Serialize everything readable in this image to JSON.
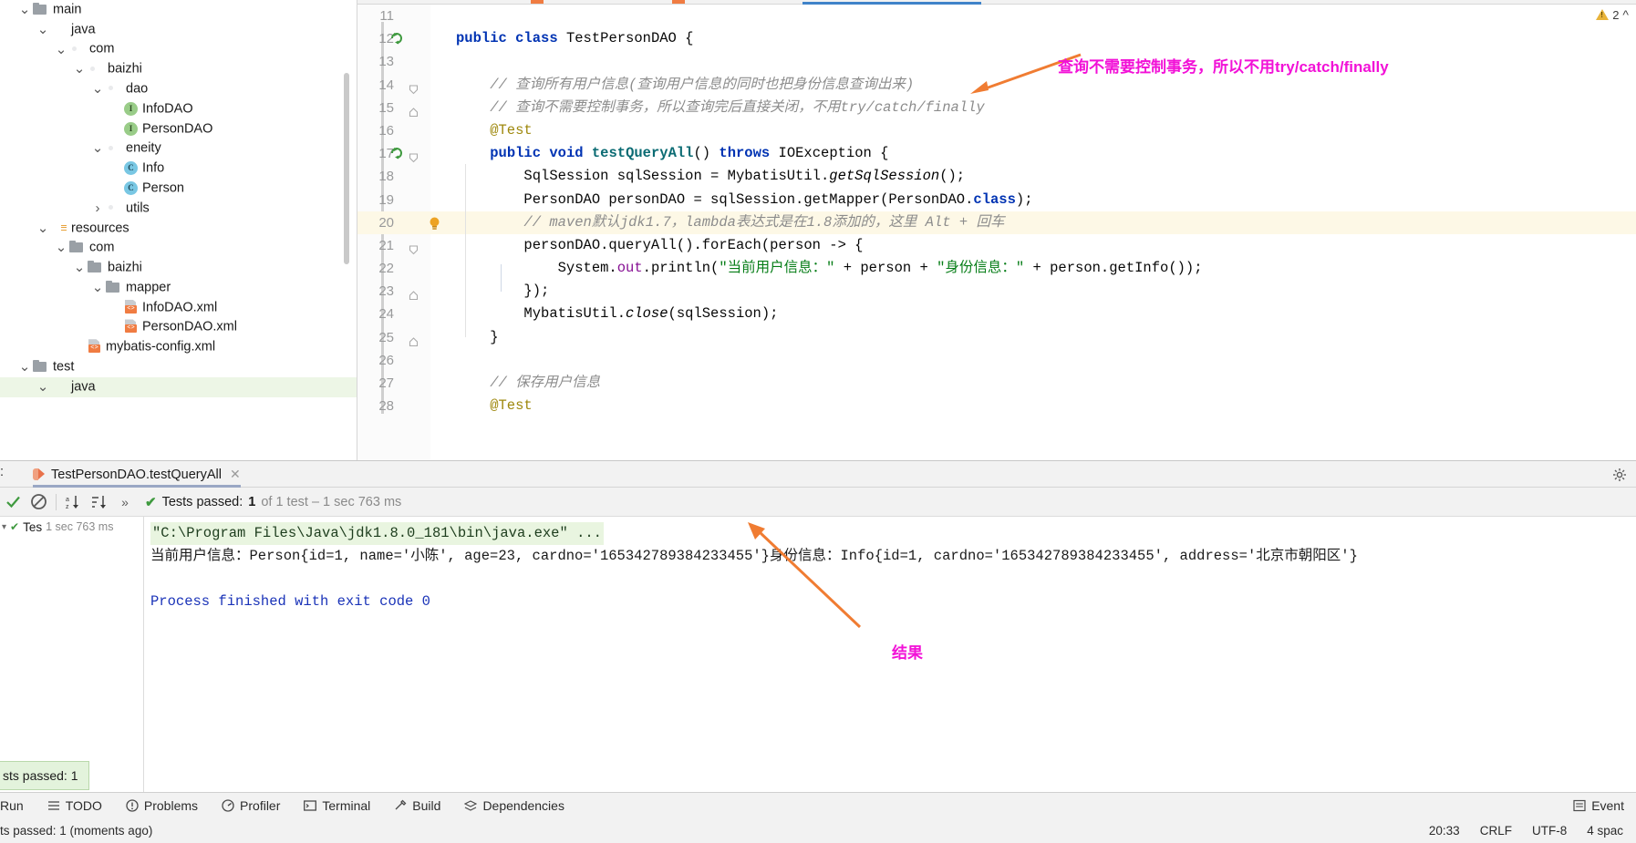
{
  "project_tree": {
    "items": [
      {
        "label": "main",
        "indent": 0,
        "twisty": "v",
        "icon": "folder",
        "selected": false
      },
      {
        "label": "java",
        "indent": 1,
        "twisty": "v",
        "icon": "folder-blue",
        "selected": false
      },
      {
        "label": "com",
        "indent": 2,
        "twisty": "v",
        "icon": "folder-src",
        "selected": false
      },
      {
        "label": "baizhi",
        "indent": 3,
        "twisty": "v",
        "icon": "folder-src",
        "selected": false
      },
      {
        "label": "dao",
        "indent": 4,
        "twisty": "v",
        "icon": "folder-src",
        "selected": false
      },
      {
        "label": "InfoDAO",
        "indent": 5,
        "twisty": "",
        "icon": "iface",
        "selected": false
      },
      {
        "label": "PersonDAO",
        "indent": 5,
        "twisty": "",
        "icon": "iface",
        "selected": false
      },
      {
        "label": "eneity",
        "indent": 4,
        "twisty": "v",
        "icon": "folder-src",
        "selected": false
      },
      {
        "label": "Info",
        "indent": 5,
        "twisty": "",
        "icon": "cls",
        "selected": false
      },
      {
        "label": "Person",
        "indent": 5,
        "twisty": "",
        "icon": "cls",
        "selected": false
      },
      {
        "label": "utils",
        "indent": 4,
        "twisty": ">",
        "icon": "folder-src",
        "selected": false
      },
      {
        "label": "resources",
        "indent": 1,
        "twisty": "v",
        "icon": "folder-res",
        "selected": false
      },
      {
        "label": "com",
        "indent": 2,
        "twisty": "v",
        "icon": "folder",
        "selected": false
      },
      {
        "label": "baizhi",
        "indent": 3,
        "twisty": "v",
        "icon": "folder",
        "selected": false
      },
      {
        "label": "mapper",
        "indent": 4,
        "twisty": "v",
        "icon": "folder",
        "selected": false
      },
      {
        "label": "InfoDAO.xml",
        "indent": 5,
        "twisty": "",
        "icon": "xml",
        "selected": false
      },
      {
        "label": "PersonDAO.xml",
        "indent": 5,
        "twisty": "",
        "icon": "xml",
        "selected": false
      },
      {
        "label": "mybatis-config.xml",
        "indent": 3,
        "twisty": "",
        "icon": "xml",
        "selected": false
      },
      {
        "label": "test",
        "indent": 0,
        "twisty": "v",
        "icon": "folder",
        "selected": false
      },
      {
        "label": "java",
        "indent": 1,
        "twisty": "v",
        "icon": "folder-green",
        "selected": true
      }
    ]
  },
  "editor": {
    "inspection_warning_count": "2",
    "lines": [
      {
        "n": "11",
        "segs": [],
        "highlight": false,
        "gutter": ""
      },
      {
        "n": "12",
        "segs": [
          {
            "t": "public ",
            "c": "kw"
          },
          {
            "t": "class ",
            "c": "kw"
          },
          {
            "t": "TestPersonDAO ",
            "c": "plain"
          },
          {
            "t": "{",
            "c": "plain"
          }
        ],
        "highlight": false,
        "gutter": "run"
      },
      {
        "n": "13",
        "segs": [],
        "highlight": false,
        "gutter": ""
      },
      {
        "n": "14",
        "segs": [
          {
            "t": "    // 查询所有用户信息(查询用户信息的同时也把身份信息查询出来)",
            "c": "cmt"
          }
        ],
        "highlight": false,
        "gutter": "fold"
      },
      {
        "n": "15",
        "segs": [
          {
            "t": "    // 查询不需要控制事务，所以查询完后直接关闭，不用try/catch/finally",
            "c": "cmt"
          }
        ],
        "highlight": false,
        "gutter": "foldend"
      },
      {
        "n": "16",
        "segs": [
          {
            "t": "    @Test",
            "c": "anno"
          }
        ],
        "highlight": false,
        "gutter": ""
      },
      {
        "n": "17",
        "segs": [
          {
            "t": "    ",
            "c": "plain"
          },
          {
            "t": "public ",
            "c": "kw"
          },
          {
            "t": "void ",
            "c": "kw"
          },
          {
            "t": "testQueryAll",
            "c": "type"
          },
          {
            "t": "() ",
            "c": "plain"
          },
          {
            "t": "throws ",
            "c": "kw"
          },
          {
            "t": "IOException {",
            "c": "plain"
          }
        ],
        "highlight": false,
        "gutter": "run-fold"
      },
      {
        "n": "18",
        "segs": [
          {
            "t": "        SqlSession sqlSession = MybatisUtil.",
            "c": "plain"
          },
          {
            "t": "getSqlSession",
            "c": "stat"
          },
          {
            "t": "();",
            "c": "plain"
          }
        ],
        "highlight": false,
        "gutter": ""
      },
      {
        "n": "19",
        "segs": [
          {
            "t": "        PersonDAO personDAO = sqlSession.getMapper(PersonDAO.",
            "c": "plain"
          },
          {
            "t": "class",
            "c": "kw"
          },
          {
            "t": ");",
            "c": "plain"
          }
        ],
        "highlight": false,
        "gutter": ""
      },
      {
        "n": "20",
        "segs": [
          {
            "t": "        // maven默认jdk1.7，lambda表达式是在1.8添加的，这里 Alt + 回车",
            "c": "cmt"
          }
        ],
        "highlight": true,
        "gutter": "bulb"
      },
      {
        "n": "21",
        "segs": [
          {
            "t": "        personDAO.queryAll().forEach(person -> {",
            "c": "plain"
          }
        ],
        "highlight": false,
        "gutter": "fold"
      },
      {
        "n": "22",
        "segs": [
          {
            "t": "            System.",
            "c": "plain"
          },
          {
            "t": "out",
            "c": "fld"
          },
          {
            "t": ".println(",
            "c": "plain"
          },
          {
            "t": "\"当前用户信息：\"",
            "c": "str"
          },
          {
            "t": " + person + ",
            "c": "plain"
          },
          {
            "t": "\"身份信息：\"",
            "c": "str"
          },
          {
            "t": " + person.getInfo());",
            "c": "plain"
          }
        ],
        "highlight": false,
        "gutter": ""
      },
      {
        "n": "23",
        "segs": [
          {
            "t": "        });",
            "c": "plain"
          }
        ],
        "highlight": false,
        "gutter": "foldend"
      },
      {
        "n": "24",
        "segs": [
          {
            "t": "        MybatisUtil.",
            "c": "plain"
          },
          {
            "t": "close",
            "c": "stat"
          },
          {
            "t": "(sqlSession);",
            "c": "plain"
          }
        ],
        "highlight": false,
        "gutter": ""
      },
      {
        "n": "25",
        "segs": [
          {
            "t": "    }",
            "c": "plain"
          }
        ],
        "highlight": false,
        "gutter": "foldend"
      },
      {
        "n": "26",
        "segs": [],
        "highlight": false,
        "gutter": ""
      },
      {
        "n": "27",
        "segs": [
          {
            "t": "    // 保存用户信息",
            "c": "cmt"
          }
        ],
        "highlight": false,
        "gutter": ""
      },
      {
        "n": "28",
        "segs": [
          {
            "t": "    @Test",
            "c": "anno"
          }
        ],
        "highlight": false,
        "gutter": ""
      }
    ]
  },
  "annotations": [
    {
      "text": "查询不需要控制事务，所以不用try/catch/finally",
      "color": "#f211d7"
    },
    {
      "text": "结果",
      "color": "#f211d7"
    }
  ],
  "run_window": {
    "tab_prefix": ":",
    "tab_label": "TestPersonDAO.testQueryAll",
    "tests_passed_label": "Tests passed:",
    "tests_passed_count": "1",
    "tests_passed_detail": "of 1 test – 1 sec 763 ms",
    "test_tree": {
      "name": "Tes",
      "time": "1 sec 763 ms"
    },
    "console": {
      "command": "\"C:\\Program Files\\Java\\jdk1.8.0_181\\bin\\java.exe\" ...",
      "output": "当前用户信息：Person{id=1, name='小陈', age=23, cardno='165342789384233455'}身份信息：Info{id=1, cardno='165342789384233455', address='北京市朝阳区'}",
      "exit": "Process finished with exit code 0"
    },
    "balloon": "sts passed: 1"
  },
  "bottom_bar": {
    "run_label": "Run",
    "items": [
      {
        "label": "TODO",
        "icon": "list-icon"
      },
      {
        "label": "Problems",
        "icon": "problems-icon"
      },
      {
        "label": "Profiler",
        "icon": "profiler-icon"
      },
      {
        "label": "Terminal",
        "icon": "terminal-icon"
      },
      {
        "label": "Build",
        "icon": "build-icon"
      },
      {
        "label": "Dependencies",
        "icon": "dependencies-icon"
      }
    ],
    "event_log": "Event"
  },
  "status_bar": {
    "left": "ts passed: 1 (moments ago)",
    "time": "20:33",
    "line_sep": "CRLF",
    "encoding": "UTF-8",
    "indent": "4 spac"
  }
}
